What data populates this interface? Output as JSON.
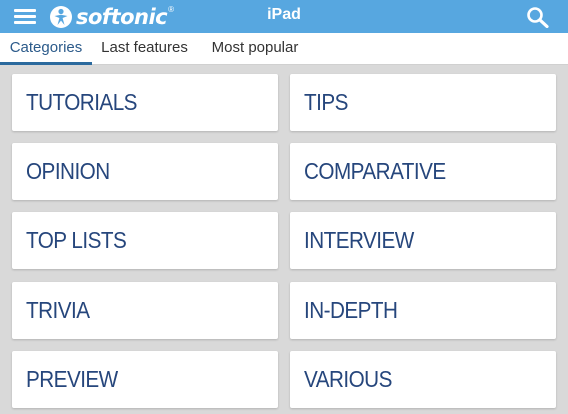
{
  "header": {
    "brand": "softonic",
    "brand_mark": "®",
    "title": "iPad",
    "menu_icon": "hamburger-menu-icon",
    "search_icon": "search-icon",
    "background_color": "#57a7e0"
  },
  "tabs": [
    {
      "label": "Categories",
      "active": true
    },
    {
      "label": "Last features",
      "active": false
    },
    {
      "label": "Most popular",
      "active": false
    }
  ],
  "categories": [
    "TUTORIALS",
    "TIPS",
    "OPINION",
    "COMPARATIVE",
    "TOP LISTS",
    "INTERVIEW",
    "TRIVIA",
    "IN-DEPTH",
    "PREVIEW",
    "VARIOUS"
  ],
  "colors": {
    "accent": "#57a7e0",
    "category_text": "#26467c",
    "page_background": "#d9d9d9"
  }
}
